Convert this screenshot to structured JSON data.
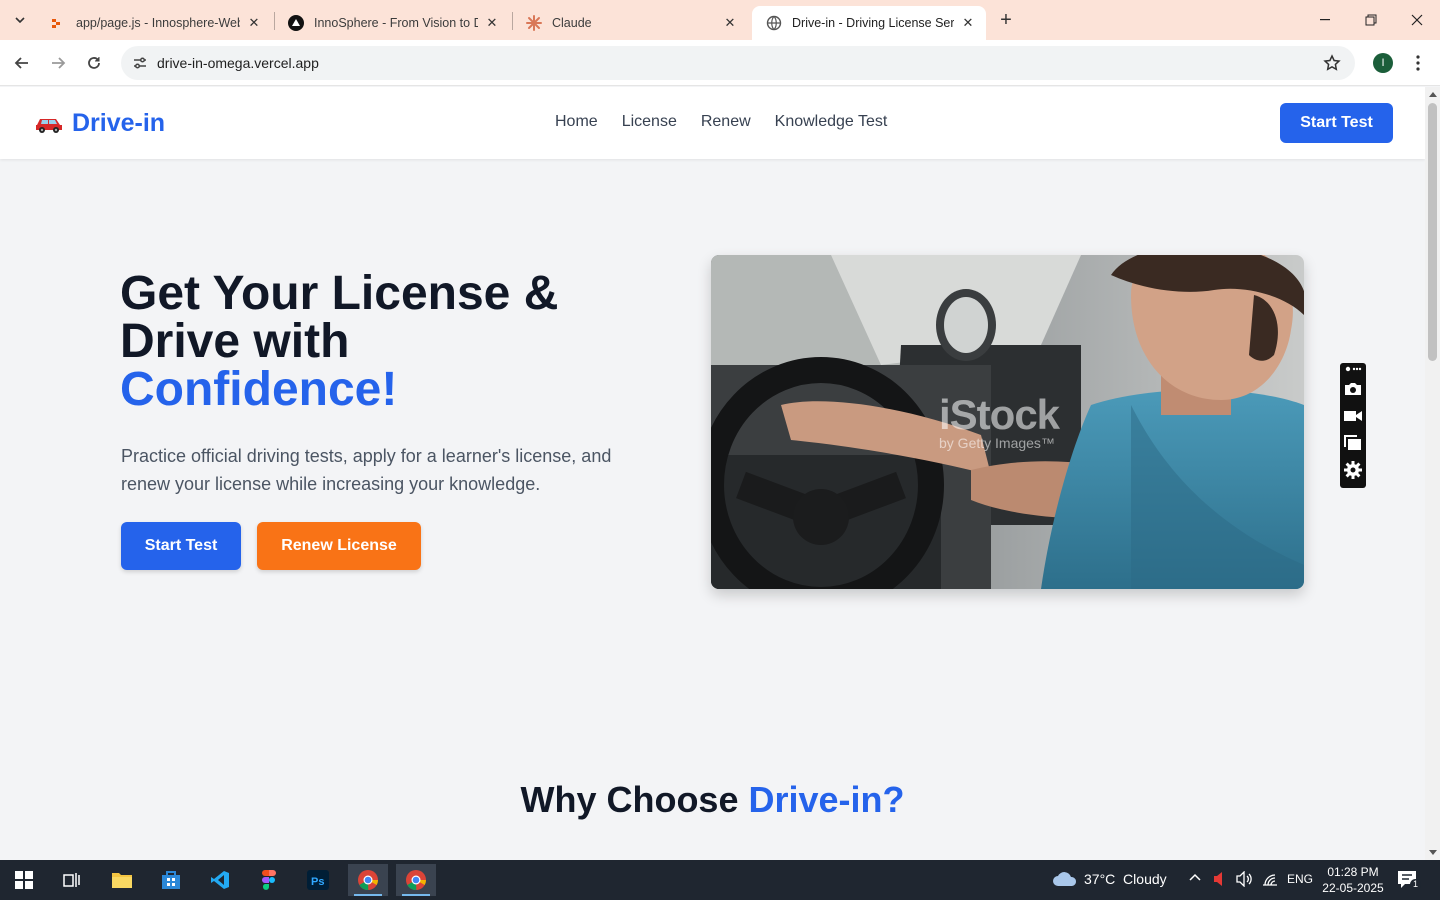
{
  "browser": {
    "tabs": [
      {
        "title": "app/page.js - Innosphere-Webs",
        "icon": "gitlab-like-icon"
      },
      {
        "title": "InnoSphere - From Vision to De",
        "icon": "vercel-triangle-icon"
      },
      {
        "title": "Claude",
        "icon": "claude-sparkle-icon"
      },
      {
        "title": "Drive-in - Driving License Servic",
        "icon": "globe-icon"
      }
    ],
    "url": "drive-in-omega.vercel.app",
    "profile_initial": "I"
  },
  "site": {
    "brand": "Drive-in",
    "brand_icon": "car-icon",
    "nav": [
      "Home",
      "License",
      "Renew",
      "Knowledge Test"
    ],
    "nav_cta": "Start Test"
  },
  "hero": {
    "title_line1": "Get Your License &",
    "title_line2": "Drive with",
    "title_accent": "Confidence!",
    "subtitle": "Practice official driving tests, apply for a learner's license, and renew your license while increasing your knowledge.",
    "primary_button": "Start Test",
    "secondary_button": "Renew License",
    "image_watermark_main": "iStock",
    "image_watermark_sub": "by Getty Images™"
  },
  "why": {
    "title_prefix": "Why Choose ",
    "title_accent": "Drive-in?"
  },
  "taskbar": {
    "weather": "37°C  Cloudy",
    "lang": "ENG",
    "time": "01:28 PM",
    "date": "22-05-2025",
    "notifications": "1"
  },
  "colors": {
    "accent": "#2563eb",
    "orange": "#f97316",
    "tabstrip": "#fce3d8"
  }
}
